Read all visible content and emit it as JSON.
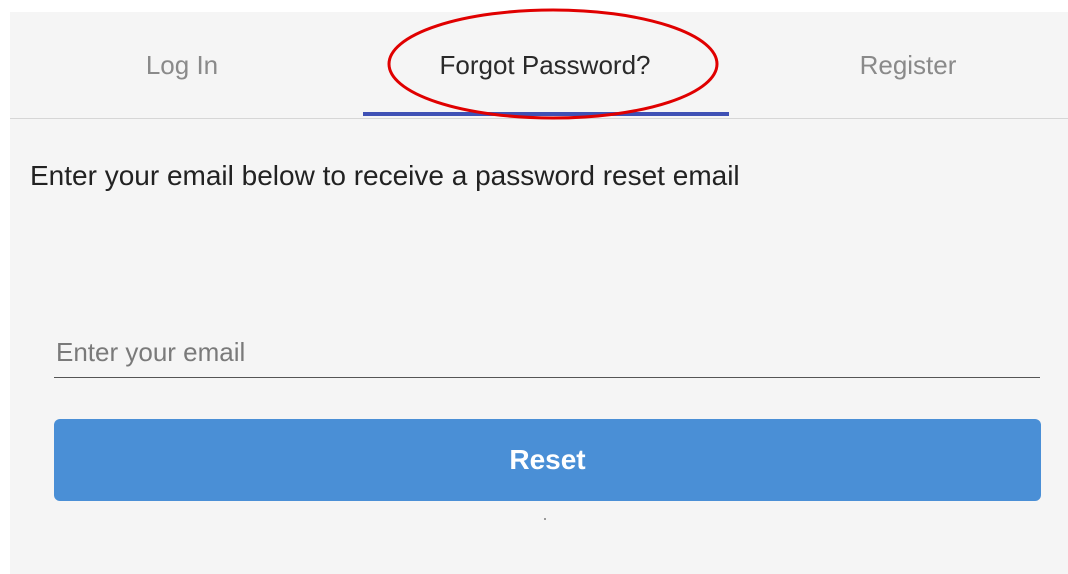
{
  "tabs": [
    {
      "label": "Log In",
      "active": false
    },
    {
      "label": "Forgot Password?",
      "active": true
    },
    {
      "label": "Register",
      "active": false
    }
  ],
  "instruction": "Enter your email below to receive a password reset email",
  "email": {
    "placeholder": "Enter your email",
    "value": ""
  },
  "reset_label": "Reset",
  "colors": {
    "panel_background": "#f5f5f5",
    "active_tab_underline": "#3f51b5",
    "button": "#4a8fd6",
    "annotation": "#e00000"
  }
}
